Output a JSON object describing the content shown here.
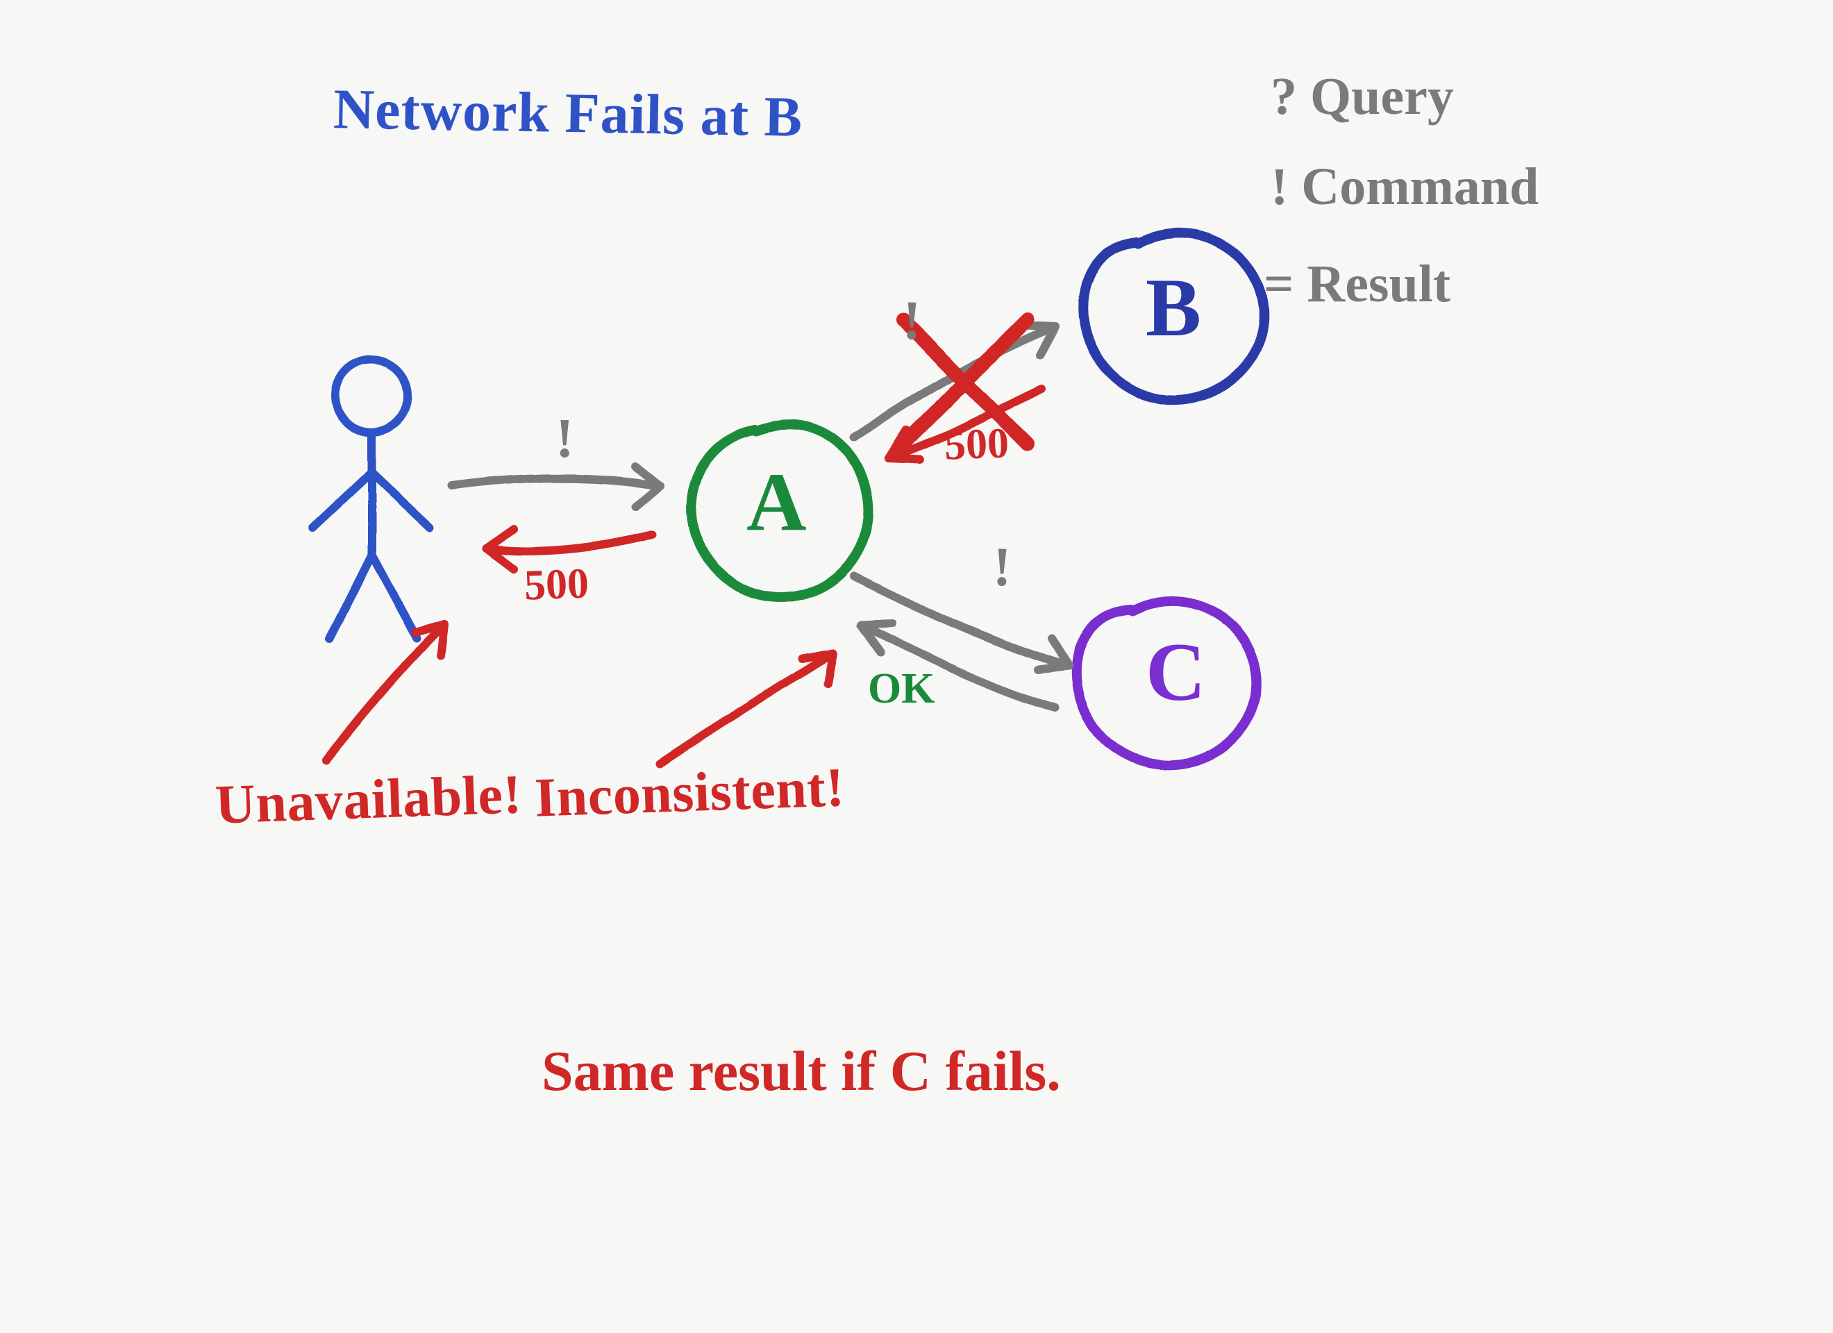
{
  "title": "Network Fails at B",
  "legend": {
    "query": "? Query",
    "command": "! Command",
    "result": "= Result"
  },
  "nodes": {
    "A": "A",
    "B": "B",
    "C": "C"
  },
  "edges": {
    "client_to_A": {
      "command_mark": "!",
      "response_code": "500"
    },
    "A_to_B": {
      "command_mark": "!",
      "response_code": "500",
      "failed": true
    },
    "A_to_C": {
      "command_mark": "!",
      "response_text": "OK"
    }
  },
  "annotations": {
    "unavailable": "Unavailable!",
    "inconsistent": "Inconsistent!",
    "footer": "Same result if C fails."
  },
  "colors": {
    "blue": "#2f53c7",
    "gray": "#7a7a7a",
    "red": "#d02727",
    "green": "#1a8a3a",
    "purple": "#7a2fd0",
    "bg": "#f7f7f6"
  }
}
